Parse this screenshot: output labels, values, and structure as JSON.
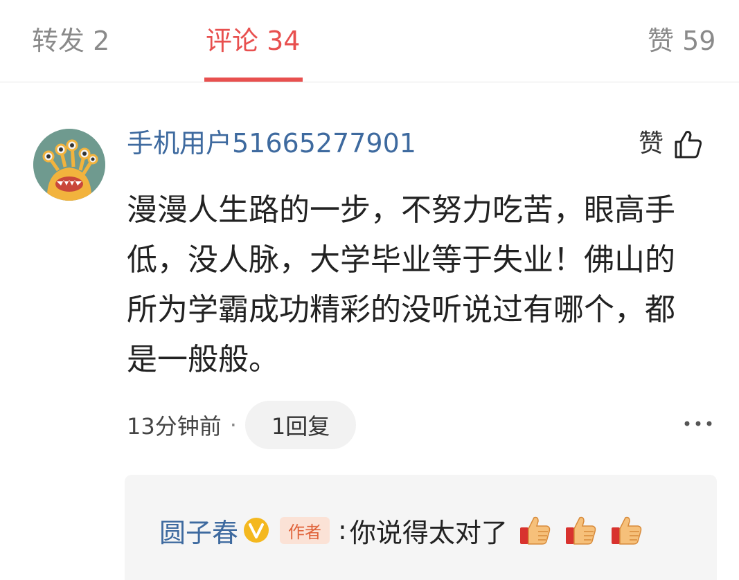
{
  "tabs": [
    {
      "label": "转发 2",
      "active": false
    },
    {
      "label": "评论 34",
      "active": true
    },
    {
      "label": "赞 59",
      "active": false
    }
  ],
  "comment": {
    "username": "手机用户51665277901",
    "like_label": "赞",
    "text": "漫漫人生路的一步，不努力吃苦，眼高手低，没人脉，大学毕业等于失业！佛山的所为学霸成功精彩的没听说过有哪个，都是一般般。",
    "time": "13分钟前",
    "separator": "·",
    "reply_button": "1回复",
    "avatar_icon": "monster-avatar-icon",
    "more_icon": "more-dots-icon"
  },
  "reply": {
    "name": "圆子春",
    "verified_icon": "verified-v-icon",
    "author_badge": "作者",
    "colon": ":",
    "text": "你说得太对了",
    "emojis": [
      "thumbs-up-emoji",
      "thumbs-up-emoji",
      "thumbs-up-emoji"
    ]
  },
  "colors": {
    "accent": "#e8504f",
    "link_blue": "#3e6a9f",
    "muted": "#8a8a8a"
  }
}
